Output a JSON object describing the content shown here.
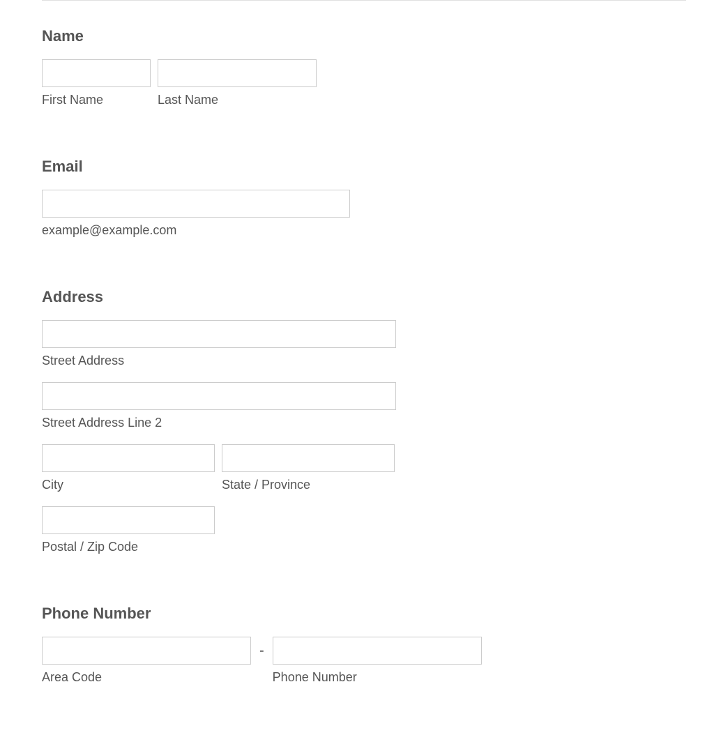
{
  "sections": {
    "name": {
      "heading": "Name",
      "firstName": {
        "label": "First Name",
        "value": ""
      },
      "lastName": {
        "label": "Last Name",
        "value": ""
      }
    },
    "email": {
      "heading": "Email",
      "field": {
        "label": "example@example.com",
        "value": ""
      }
    },
    "address": {
      "heading": "Address",
      "street1": {
        "label": "Street Address",
        "value": ""
      },
      "street2": {
        "label": "Street Address Line 2",
        "value": ""
      },
      "city": {
        "label": "City",
        "value": ""
      },
      "state": {
        "label": "State / Province",
        "value": ""
      },
      "postal": {
        "label": "Postal / Zip Code",
        "value": ""
      }
    },
    "phone": {
      "heading": "Phone Number",
      "separator": "-",
      "areaCode": {
        "label": "Area Code",
        "value": ""
      },
      "number": {
        "label": "Phone Number",
        "value": ""
      }
    }
  }
}
